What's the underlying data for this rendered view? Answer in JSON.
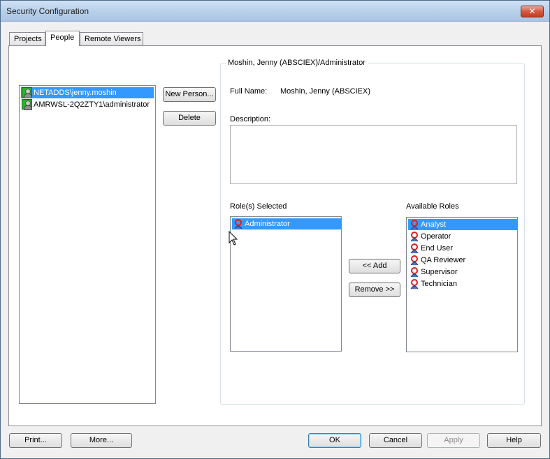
{
  "window": {
    "title": "Security Configuration",
    "close_glyph": "✕"
  },
  "tabs": [
    {
      "label": "Projects",
      "active": false
    },
    {
      "label": "People",
      "active": true
    },
    {
      "label": "Remote Viewers",
      "active": false
    }
  ],
  "people": {
    "items": [
      {
        "label": "NETADDS\\jenny.moshin",
        "selected": true,
        "icon": "person-icon"
      },
      {
        "label": "AMRWSL-2Q2ZTY1\\administrator",
        "selected": false,
        "icon": "person-icon"
      }
    ],
    "new_person_label": "New Person...",
    "delete_label": "Delete"
  },
  "details": {
    "group_title": "Moshin, Jenny (ABSCIEX)/Administrator",
    "full_name_label": "Full Name:",
    "full_name_value": "Moshin, Jenny (ABSCIEX)",
    "description_label": "Description:",
    "description_value": "",
    "roles_selected_label": "Role(s) Selected",
    "available_roles_label": "Available Roles",
    "selected_roles": [
      {
        "label": "Administrator",
        "selected": true,
        "icon": "role-icon"
      }
    ],
    "available_roles": [
      {
        "label": "Analyst",
        "selected": true,
        "icon": "role-icon"
      },
      {
        "label": "Operator",
        "selected": false,
        "icon": "role-icon"
      },
      {
        "label": "End User",
        "selected": false,
        "icon": "role-icon"
      },
      {
        "label": "QA Reviewer",
        "selected": false,
        "icon": "role-icon"
      },
      {
        "label": "Supervisor",
        "selected": false,
        "icon": "role-icon"
      },
      {
        "label": "Technician",
        "selected": false,
        "icon": "role-icon"
      }
    ],
    "add_label": "<< Add",
    "remove_label": "Remove >>"
  },
  "footer": {
    "print_label": "Print...",
    "more_label": "More...",
    "ok_label": "OK",
    "cancel_label": "Cancel",
    "apply_label": "Apply",
    "help_label": "Help"
  },
  "colors": {
    "selection": "#3399ff",
    "person_icon": "#2bb52b",
    "role_icon": "#d42020"
  }
}
